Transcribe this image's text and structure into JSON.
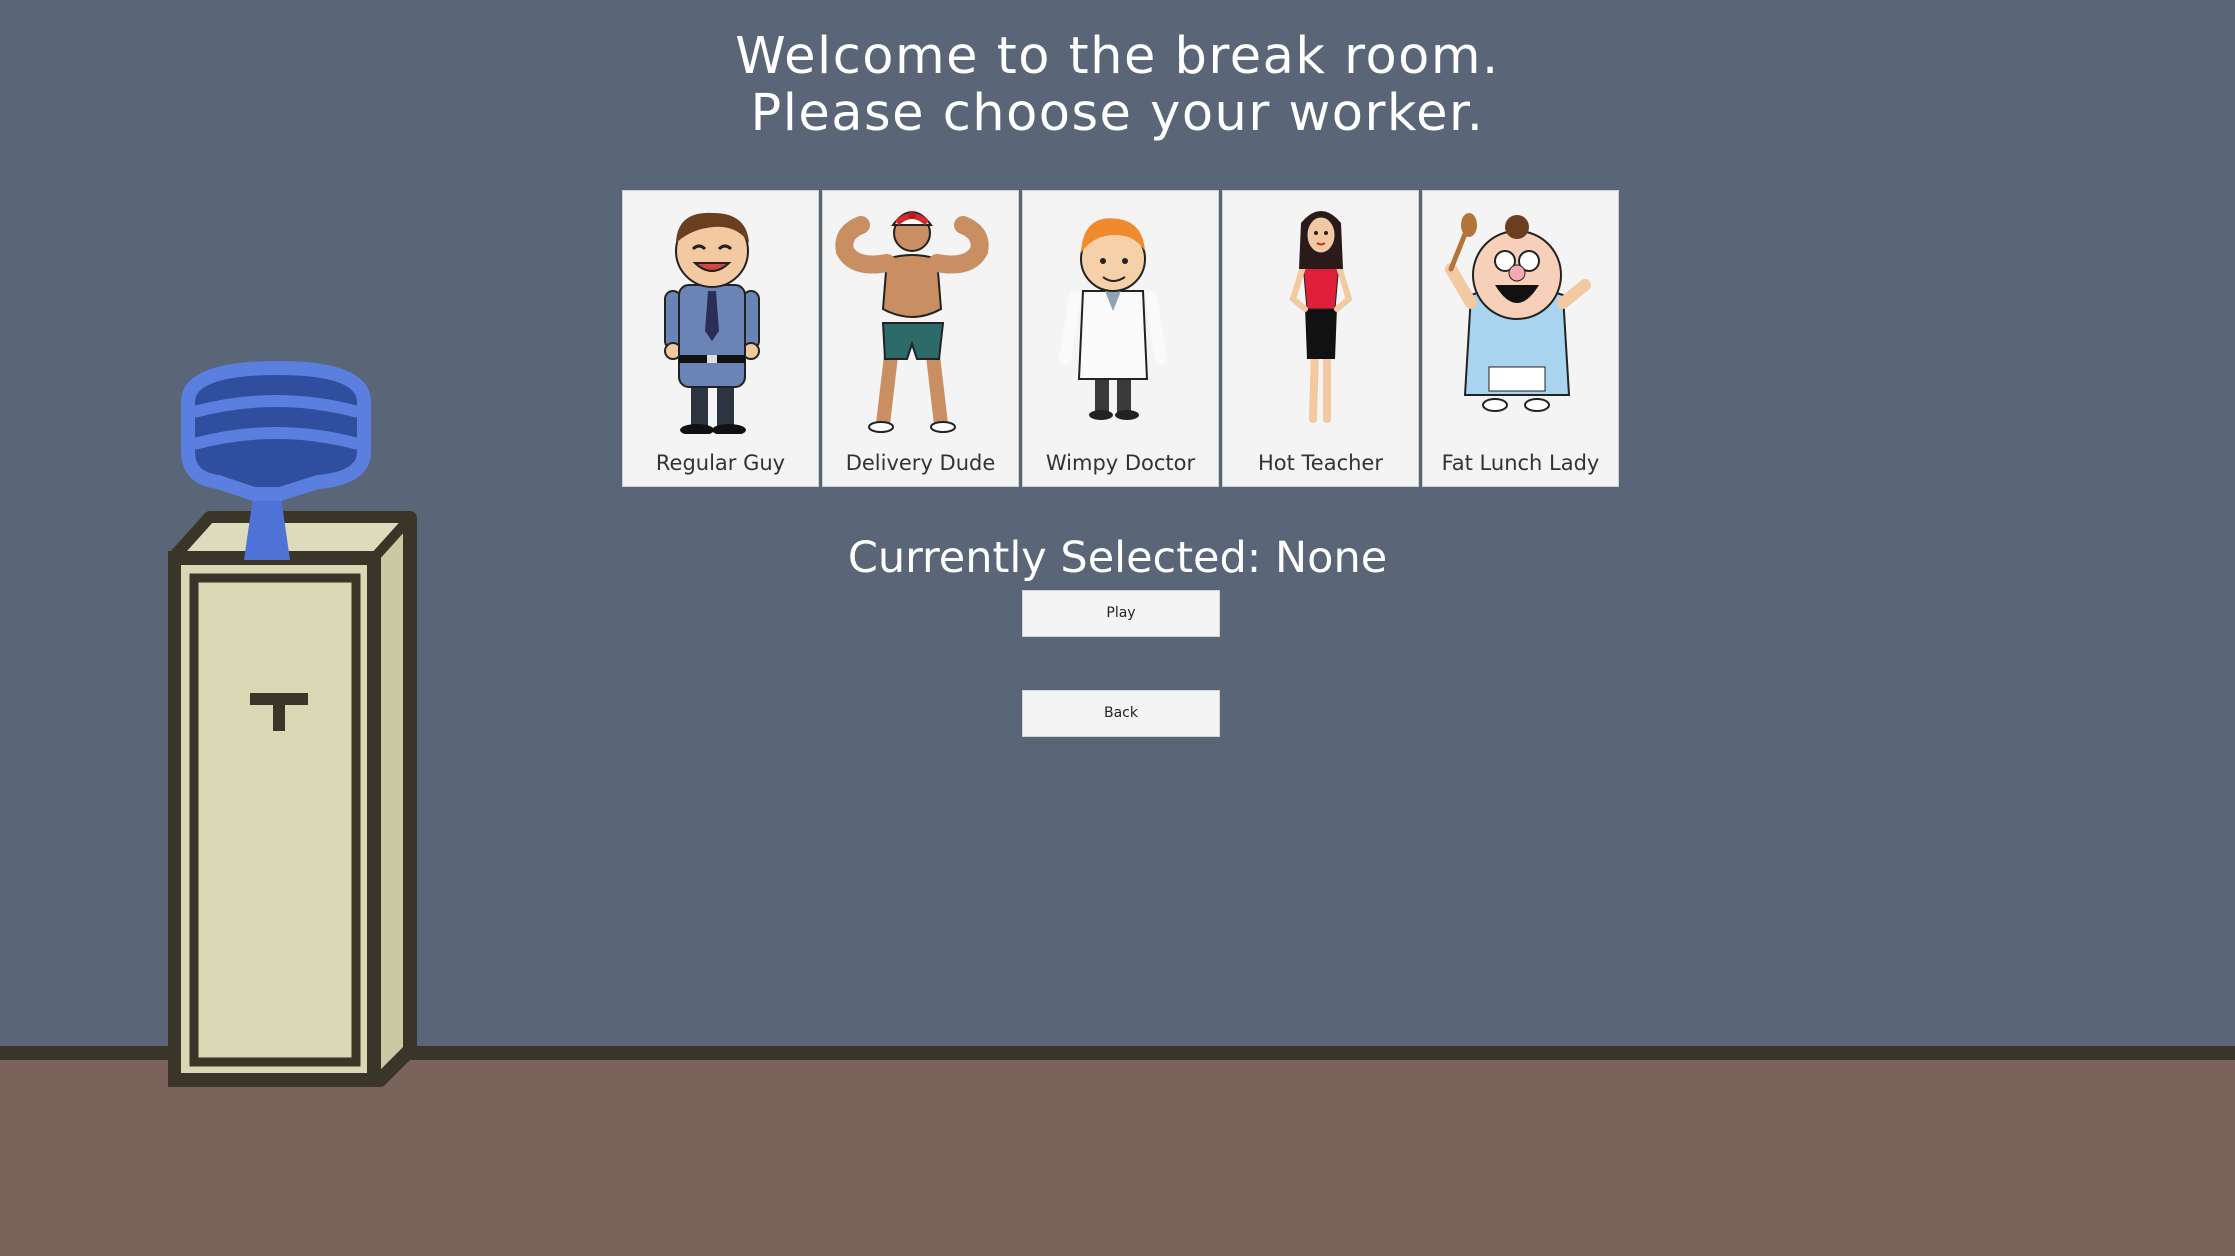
{
  "title": {
    "line1": "Welcome to the break room.",
    "line2": "Please choose your worker."
  },
  "workers": [
    {
      "label": "Regular Guy",
      "icon": "regular-guy-portrait"
    },
    {
      "label": "Delivery Dude",
      "icon": "delivery-dude-portrait"
    },
    {
      "label": "Wimpy Doctor",
      "icon": "wimpy-doctor-portrait"
    },
    {
      "label": "Hot Teacher",
      "icon": "hot-teacher-portrait"
    },
    {
      "label": "Fat Lunch Lady",
      "icon": "fat-lunch-lady-portrait"
    }
  ],
  "selection": {
    "text": "Currently Selected: None"
  },
  "buttons": {
    "play": "Play",
    "back": "Back"
  },
  "colors": {
    "wall": "#5a6678",
    "floor": "#7a615a",
    "card": "#f4f4f4",
    "cooler_body": "#d8d8b4",
    "water_jug": "#4f72d6"
  }
}
